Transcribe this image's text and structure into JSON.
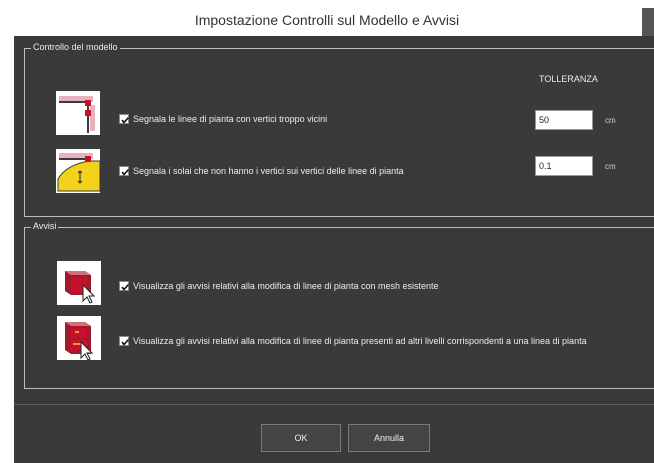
{
  "window": {
    "title": "Impostazione Controlli sul Modello e Avvisi"
  },
  "model_checks": {
    "group_label": "Controllo del modello",
    "tolerance_header": "TOLLERANZA",
    "rows": [
      {
        "label": "Segnala le linee di pianta con vertici troppo vicini",
        "checked": true,
        "value": "50",
        "unit": "cm",
        "icon": "close-vertices-icon"
      },
      {
        "label": "Segnala i solai che non hanno i vertici sui vertici delle linee di pianta",
        "checked": true,
        "value": "0.1",
        "unit": "cm",
        "icon": "slab-vertices-icon"
      }
    ]
  },
  "warnings": {
    "group_label": "Avvisi",
    "rows": [
      {
        "label": "Visualizza gli avvisi relativi alla modifica di linee di pianta con mesh esistente",
        "checked": true,
        "icon": "mesh-edit-warning-icon"
      },
      {
        "label": "Visualizza gli avvisi relativi alla modifica di linee di pianta presenti ad altri livelli corrispondenti a una linea di pianta",
        "checked": true,
        "icon": "multilevel-edit-warning-icon"
      }
    ]
  },
  "buttons": {
    "ok": "OK",
    "cancel": "Annulla"
  },
  "colors": {
    "dialog_background": "#3a3a3a",
    "text": "#ececec",
    "group_border": "#bdbdbd",
    "icon_accent": "#c8102e",
    "icon_yellow": "#f2d21b"
  }
}
